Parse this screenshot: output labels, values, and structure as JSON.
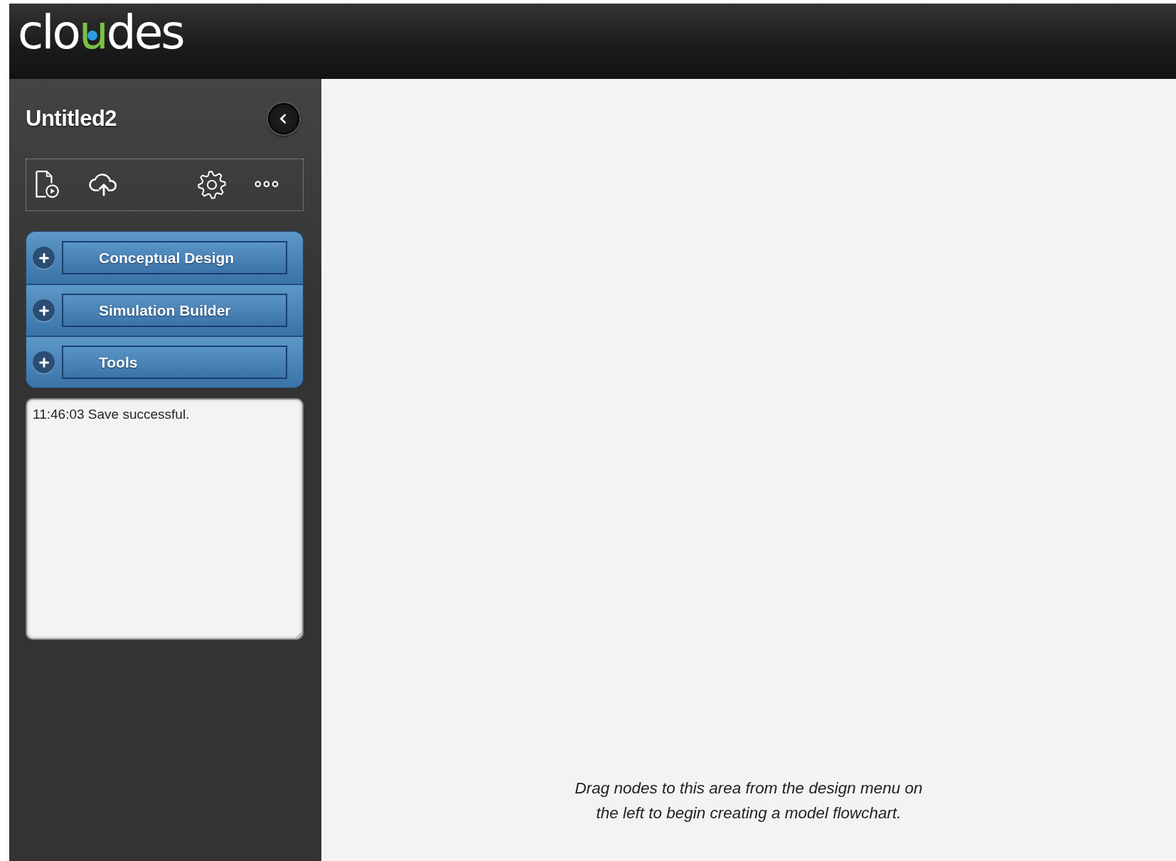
{
  "header": {
    "logo": {
      "before": "clo",
      "accent": "u",
      "after": "des"
    }
  },
  "sidebar": {
    "title": "Untitled2",
    "collapsed": false,
    "toolbar": [
      {
        "kind": "document-play"
      },
      {
        "kind": "cloud-upload"
      },
      {
        "kind": "settings"
      },
      {
        "kind": "more"
      }
    ],
    "sections": [
      {
        "label": "Conceptual Design",
        "expanded": false
      },
      {
        "label": "Simulation Builder",
        "expanded": false
      },
      {
        "label": "Tools",
        "expanded": false
      }
    ],
    "log": {
      "value": "11:46:03 Save successful."
    }
  },
  "canvas": {
    "hint": "Drag nodes to this area from the design menu on the left to begin creating a model flowchart."
  }
}
